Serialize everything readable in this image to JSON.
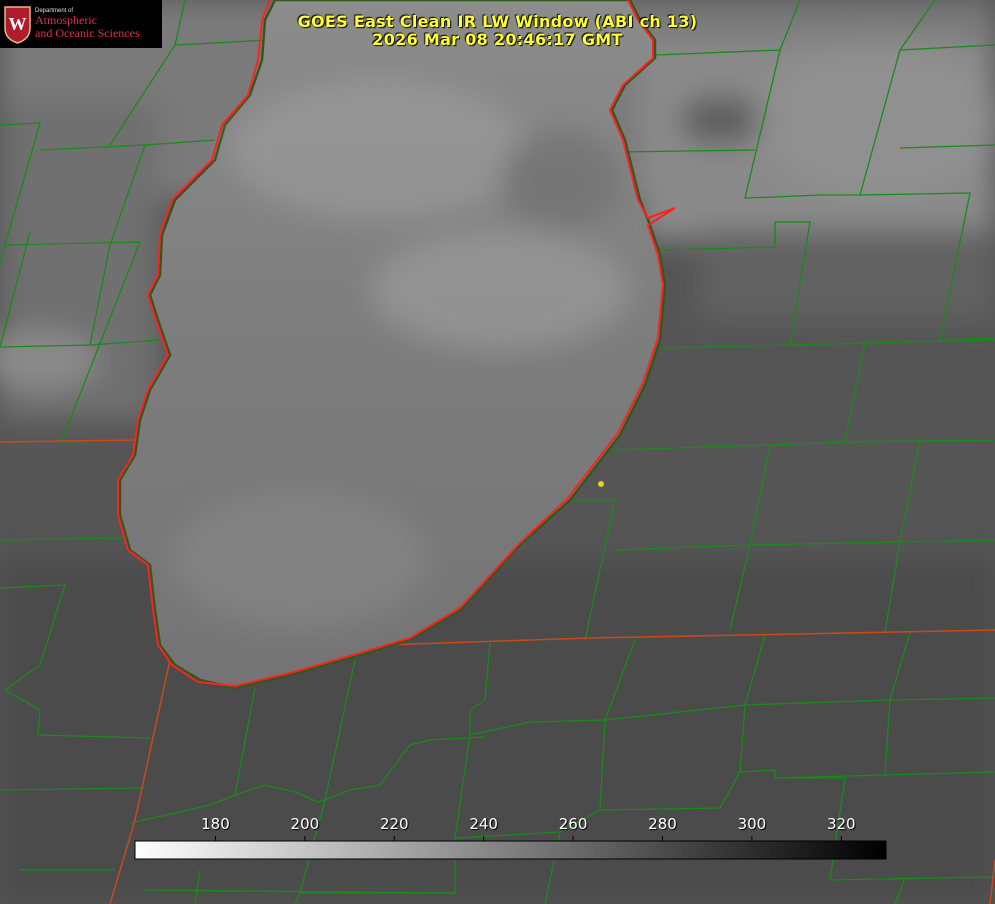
{
  "title": {
    "line1": "GOES East Clean IR LW Window (ABI ch 13)",
    "line2": "2026 Mar 08 20:46:17 GMT"
  },
  "logo": {
    "department": "Department of",
    "line1": "Atmospheric",
    "line2": "and Oceanic Sciences",
    "emblem": "W"
  },
  "colorbar": {
    "ticks": [
      "180",
      "200",
      "220",
      "240",
      "260",
      "280",
      "300",
      "320"
    ],
    "range": [
      162,
      330
    ],
    "gradient": [
      "#ffffff",
      "#000000"
    ]
  },
  "colors": {
    "title": "#ffff33",
    "coastline": "#ff2020",
    "county_lines": "#1a8a1a",
    "state_lines": "#c84a1a",
    "marker": "#e6d21e"
  }
}
